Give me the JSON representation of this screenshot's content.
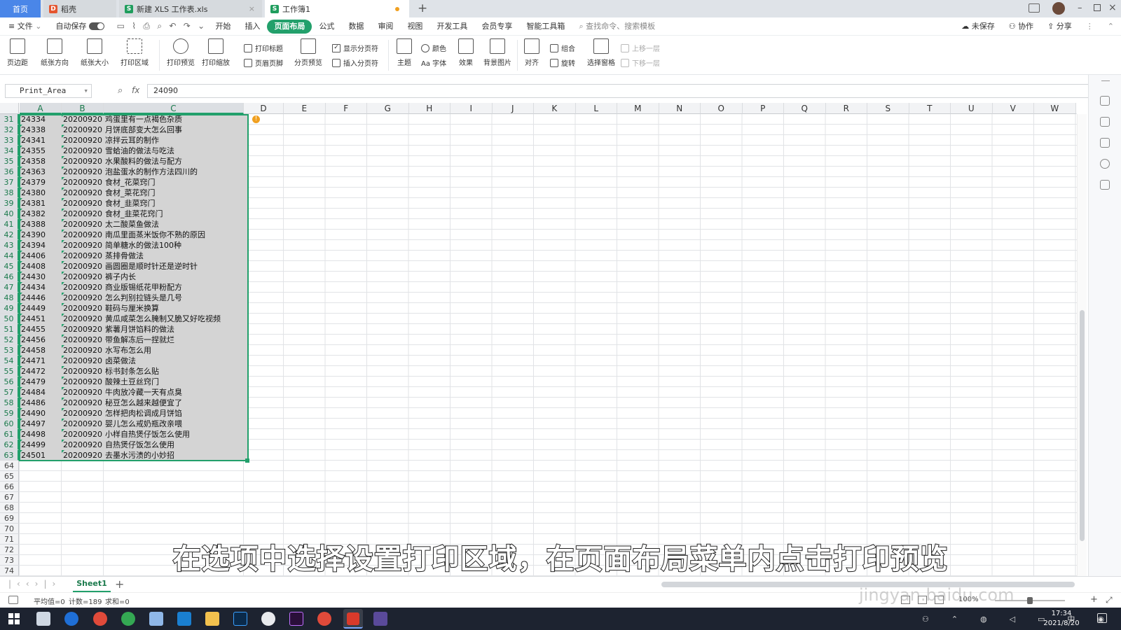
{
  "tabs": [
    {
      "label": "首页",
      "active": true
    },
    {
      "label": "稻壳"
    },
    {
      "label": "新建 XLS 工作表.xls"
    },
    {
      "label": "工作簿1",
      "current": true
    }
  ],
  "menu": {
    "file": "文件",
    "autosave": "自动保存",
    "items": [
      "开始",
      "插入",
      "页面布局",
      "公式",
      "数据",
      "审阅",
      "视图",
      "开发工具",
      "会员专享",
      "智能工具箱"
    ],
    "search_placeholder": "查找命令、搜索模板",
    "unsaved": "未保存",
    "collab": "协作",
    "share": "分享"
  },
  "ribbon": {
    "margins": "页边距",
    "orientation": "纸张方向",
    "size": "纸张大小",
    "print_area": "打印区域",
    "print_preview": "打印预览",
    "print_scale": "打印缩放",
    "print_titles": "打印标题",
    "header_footer": "页眉页脚",
    "show_page_breaks": "显示分页符",
    "page_break_preview": "分页预览",
    "insert_page_break": "插入分页符",
    "theme": "主题",
    "colors": "颜色",
    "fonts": "Aa 字体",
    "effects": "效果",
    "background": "背景图片",
    "align": "对齐",
    "group": "组合",
    "rotate": "旋转",
    "selection_pane": "选择窗格",
    "bring_forward": "上移一层",
    "send_backward": "下移一层"
  },
  "formula_bar": {
    "name_box": "Print_Area",
    "fx": "fx",
    "value": "24090"
  },
  "columns": [
    "A",
    "B",
    "C",
    "D",
    "E",
    "F",
    "G",
    "H",
    "I",
    "J",
    "K",
    "L",
    "M",
    "N",
    "O",
    "P",
    "Q",
    "R",
    "S",
    "T",
    "U",
    "V",
    "W"
  ],
  "rows": [
    {
      "n": "31",
      "a": "24334",
      "b": "20200920",
      "c": "鸡蛋里有一点褐色杂质"
    },
    {
      "n": "32",
      "a": "24338",
      "b": "20200920",
      "c": "月饼底部变大怎么回事"
    },
    {
      "n": "33",
      "a": "24341",
      "b": "20200920",
      "c": "凉拌云耳的制作"
    },
    {
      "n": "34",
      "a": "24355",
      "b": "20200920",
      "c": "雪蛤油的做法与吃法"
    },
    {
      "n": "35",
      "a": "24358",
      "b": "20200920",
      "c": "水果酸料的做法与配方"
    },
    {
      "n": "36",
      "a": "24363",
      "b": "20200920",
      "c": "泡盐蛋水的制作方法四川的"
    },
    {
      "n": "37",
      "a": "24379",
      "b": "20200920",
      "c": "食材_花菜窍门"
    },
    {
      "n": "38",
      "a": "24380",
      "b": "20200920",
      "c": "食材_菜花窍门"
    },
    {
      "n": "39",
      "a": "24381",
      "b": "20200920",
      "c": "食材_韭菜窍门"
    },
    {
      "n": "40",
      "a": "24382",
      "b": "20200920",
      "c": "食材_韭菜花窍门"
    },
    {
      "n": "41",
      "a": "24388",
      "b": "20200920",
      "c": "太二酸菜鱼做法"
    },
    {
      "n": "42",
      "a": "24390",
      "b": "20200920",
      "c": "南瓜里面蒸米饭你不熟的原因"
    },
    {
      "n": "43",
      "a": "24394",
      "b": "20200920",
      "c": "简单糖水的做法100种"
    },
    {
      "n": "44",
      "a": "24406",
      "b": "20200920",
      "c": "蒸排骨做法"
    },
    {
      "n": "45",
      "a": "24408",
      "b": "20200920",
      "c": "画圆圈是顺时针还是逆时针"
    },
    {
      "n": "46",
      "a": "24430",
      "b": "20200920",
      "c": "裤子内长"
    },
    {
      "n": "47",
      "a": "24434",
      "b": "20200920",
      "c": "商业版锡纸花甲粉配方"
    },
    {
      "n": "48",
      "a": "24446",
      "b": "20200920",
      "c": "怎么判别拉链头是几号"
    },
    {
      "n": "49",
      "a": "24449",
      "b": "20200920",
      "c": "鞋码与厘米换算"
    },
    {
      "n": "50",
      "a": "24451",
      "b": "20200920",
      "c": "黄瓜咸菜怎么腌制又脆又好吃视频"
    },
    {
      "n": "51",
      "a": "24455",
      "b": "20200920",
      "c": "紫薯月饼馅料的做法"
    },
    {
      "n": "52",
      "a": "24456",
      "b": "20200920",
      "c": "带鱼解冻后一捏就烂"
    },
    {
      "n": "53",
      "a": "24458",
      "b": "20200920",
      "c": "水写布怎么用"
    },
    {
      "n": "54",
      "a": "24471",
      "b": "20200920",
      "c": "卤菜做法"
    },
    {
      "n": "55",
      "a": "24472",
      "b": "20200920",
      "c": "标书封条怎么贴"
    },
    {
      "n": "56",
      "a": "24479",
      "b": "20200920",
      "c": "酸辣土豆丝窍门"
    },
    {
      "n": "57",
      "a": "24484",
      "b": "20200920",
      "c": "牛肉放冷藏一天有点臭"
    },
    {
      "n": "58",
      "a": "24486",
      "b": "20200920",
      "c": "秘豆怎么越来越便宜了"
    },
    {
      "n": "59",
      "a": "24490",
      "b": "20200920",
      "c": "怎样把肉松调成月饼馅"
    },
    {
      "n": "60",
      "a": "24497",
      "b": "20200920",
      "c": "婴儿怎么戒奶瓶改亲喂"
    },
    {
      "n": "61",
      "a": "24498",
      "b": "20200920",
      "c": "小样自热煲仔饭怎么使用"
    },
    {
      "n": "62",
      "a": "24499",
      "b": "20200920",
      "c": "自热煲仔饭怎么使用"
    },
    {
      "n": "63",
      "a": "24501",
      "b": "20200920",
      "c": "去墨水污渍的小妙招"
    },
    {
      "n": "64",
      "a": "",
      "b": "",
      "c": ""
    },
    {
      "n": "65",
      "a": "",
      "b": "",
      "c": ""
    },
    {
      "n": "66",
      "a": "",
      "b": "",
      "c": ""
    },
    {
      "n": "67",
      "a": "",
      "b": "",
      "c": ""
    },
    {
      "n": "68",
      "a": "",
      "b": "",
      "c": ""
    },
    {
      "n": "69",
      "a": "",
      "b": "",
      "c": ""
    },
    {
      "n": "70",
      "a": "",
      "b": "",
      "c": ""
    },
    {
      "n": "71",
      "a": "",
      "b": "",
      "c": ""
    },
    {
      "n": "72",
      "a": "",
      "b": "",
      "c": ""
    },
    {
      "n": "73",
      "a": "",
      "b": "",
      "c": ""
    },
    {
      "n": "74",
      "a": "",
      "b": "",
      "c": ""
    }
  ],
  "sheet_tab": "Sheet1",
  "status": {
    "average": "平均值=0",
    "count": "计数=189",
    "sum": "求和=0",
    "zoom": "100%"
  },
  "taskbar": {
    "time": "17:34",
    "date": "2021/8/20",
    "ime": "中"
  },
  "caption": "在选项中选择设置打印区域，在页面布局菜单内点击打印预览",
  "watermark": "jingyan.baidu.com",
  "colors": {
    "accent": "#22a06b",
    "selection_fill": "#d4d4d4",
    "tab_bar": "#dfe3e8"
  }
}
